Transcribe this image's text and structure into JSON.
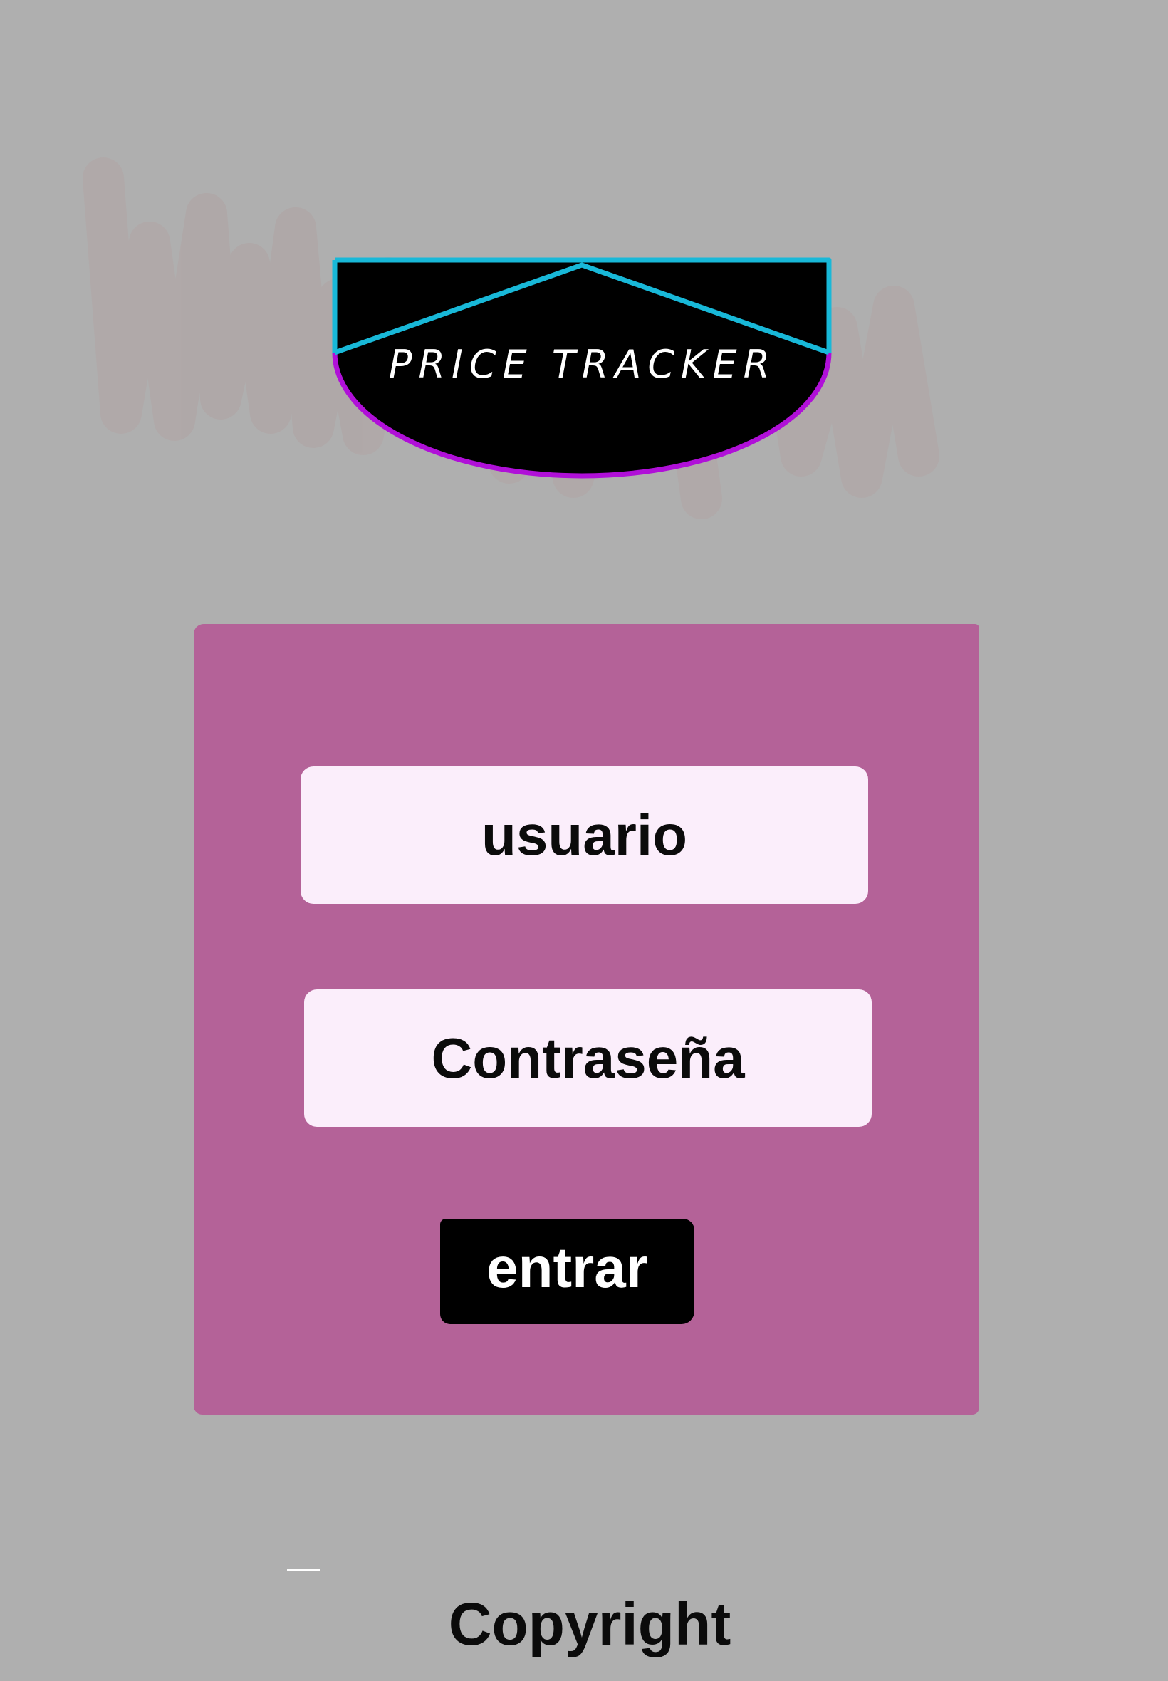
{
  "logo": {
    "text": "PRICE TRACKER",
    "colors": {
      "fill": "#000000",
      "top_outline": "#18b8d8",
      "bottom_outline": "#b010d8",
      "text": "#ffffff"
    }
  },
  "login_form": {
    "username_placeholder": "usuario",
    "password_placeholder": "Contraseña",
    "submit_label": "entrar"
  },
  "footer": {
    "copyright": "Copyright"
  },
  "colors": {
    "background": "#afafaf",
    "panel": "#b46298",
    "field": "#fbeefb",
    "button": "#000000",
    "text_dark": "#0b0b0b"
  }
}
